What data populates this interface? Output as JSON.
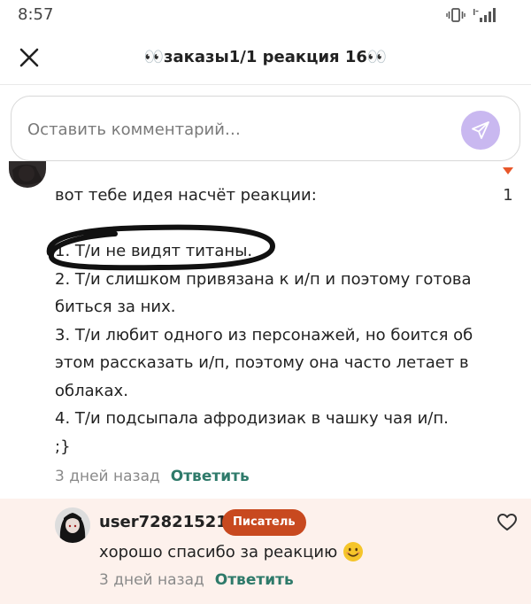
{
  "status_bar": {
    "time": "8:57"
  },
  "header": {
    "title": "👀заказы1/1 реакция 16👀"
  },
  "comment_box": {
    "placeholder": "Оставить комментарий…"
  },
  "comment": {
    "like_count": "1",
    "lines": [
      "вот тебе идея насчёт реакции:",
      "",
      "1. Т/и не видят титаны.",
      "2. Т/и слишком привязана к и/п и поэтому готова",
      "биться за них.",
      "3. Т/и любит одного из персонажей, но боится об",
      "этом рассказать и/п, поэтому она часто летает в",
      "облаках.",
      "4. Т/и подсыпала афродизиак в чашку чая и/п.",
      ";}"
    ],
    "time": "3 дней назад",
    "reply_label": "Ответить"
  },
  "reply": {
    "username": "user72821521",
    "badge": "Писатель",
    "text": "хорошо спасибо  за реакцию",
    "time": "3 дней назад",
    "reply_label": "Ответить"
  },
  "colors": {
    "accent_send": "#c9b8f0",
    "badge": "#c8491f",
    "reply_link": "#2e7a6a",
    "reply_bg": "#fdf1ec",
    "like_arrow": "#e8572a"
  },
  "icons": [
    "vibrate-icon",
    "signal-icon",
    "close-icon",
    "send-icon",
    "like-arrow-icon",
    "heart-icon",
    "smile-emoji-icon"
  ]
}
